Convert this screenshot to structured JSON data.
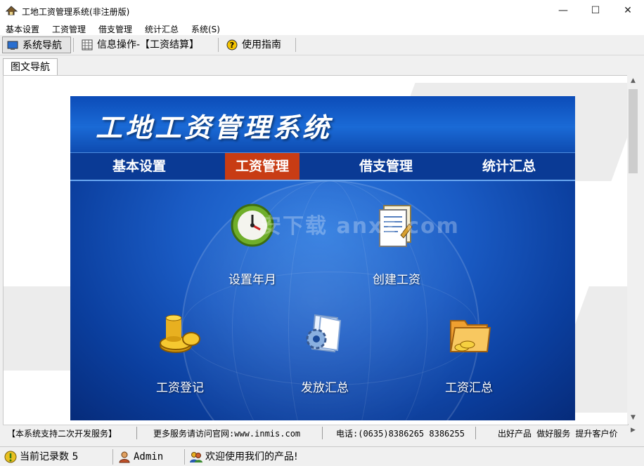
{
  "window": {
    "title": "工地工资管理系统(非注册版)",
    "minimize": "—",
    "maximize": "☐",
    "close": "✕"
  },
  "menu": [
    "基本设置",
    "工资管理",
    "借支管理",
    "统计汇总",
    "系统(S)"
  ],
  "toolbar": {
    "nav_label": "系统导航",
    "info_label": "信息操作-【工资结算】",
    "guide_label": "使用指南"
  },
  "tab": {
    "label": "图文导航"
  },
  "panel": {
    "title": "工地工资管理系统",
    "nav": [
      {
        "label": "基本设置",
        "active": false
      },
      {
        "label": "工资管理",
        "active": true
      },
      {
        "label": "借支管理",
        "active": false
      },
      {
        "label": "统计汇总",
        "active": false
      }
    ],
    "functions": [
      {
        "label": "设置年月",
        "icon": "clock-icon"
      },
      {
        "label": "创建工资",
        "icon": "document-icon"
      },
      {
        "label": "工资登记",
        "icon": "coins-icon"
      },
      {
        "label": "发放汇总",
        "icon": "gear-document-icon"
      },
      {
        "label": "工资汇总",
        "icon": "folder-coins-icon"
      }
    ],
    "watermark": "安下载 anxz.com"
  },
  "status1": {
    "support": "【本系统支持二次开发服务】",
    "website": "更多服务请访问官网:www.inmis.com",
    "phone": "电话:(0635)8386265 8386255",
    "slogan": "出好产品 做好服务 提升客户价"
  },
  "status2": {
    "record_count": "当前记录数 5",
    "user": "Admin",
    "welcome": "欢迎使用我们的产品!"
  },
  "colors": {
    "panel_blue": "#1a5bc4",
    "active_nav": "#c83c14"
  }
}
